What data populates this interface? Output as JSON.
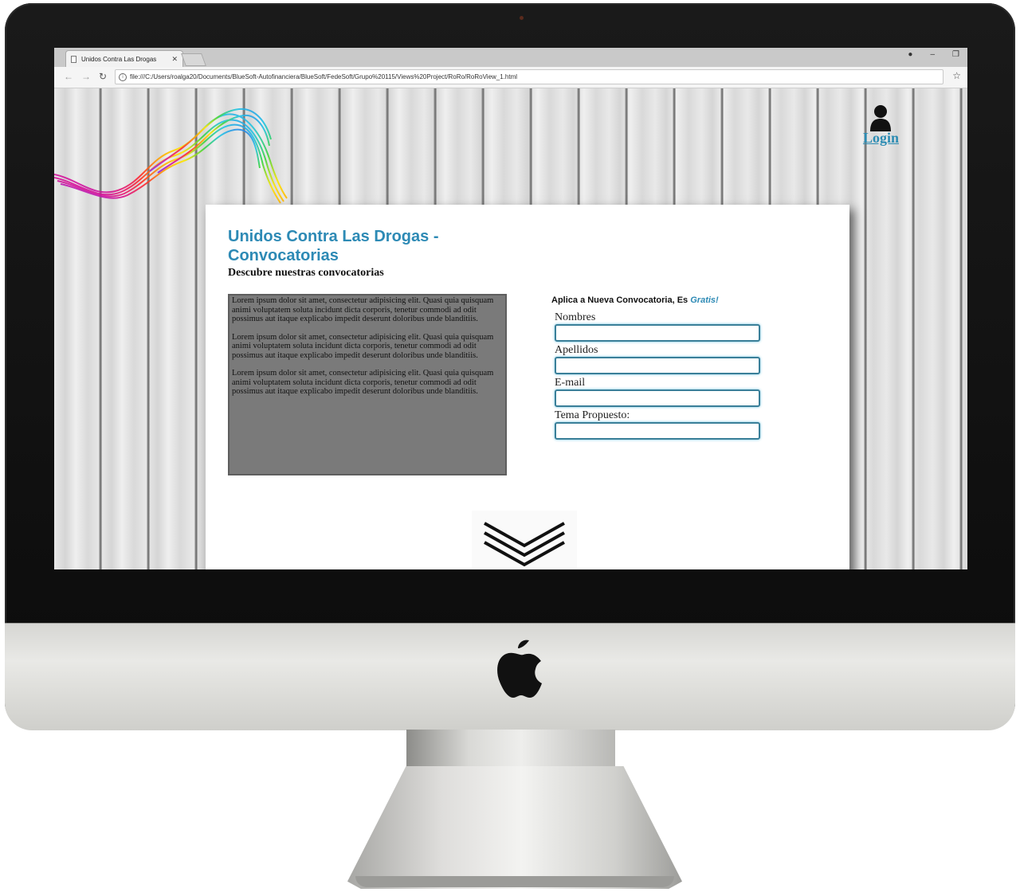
{
  "browser": {
    "tab_title": "Unidos Contra Las Drogas",
    "tab_close": "✕",
    "address": "file:///C:/Users/roalga20/Documents/BlueSoft-Autofinanciera/BlueSoft/FedeSoft/Grupo%20115/Views%20Project/RoRo/RoRoView_1.html",
    "controls": {
      "minimize": "–",
      "restore": "❐",
      "account": "●"
    }
  },
  "header": {
    "login_label": "Login"
  },
  "main": {
    "title": "Unidos Contra Las Drogas - Convocatorias",
    "subtitle": "Descubre nuestras convocatorias",
    "paragraphs": [
      "Lorem ipsum dolor sit amet, consectetur adipisicing elit. Quasi quia quisquam animi voluptatem soluta incidunt dicta corporis, tenetur commodi ad odit possimus aut itaque explicabo impedit deserunt doloribus unde blanditiis.",
      "Lorem ipsum dolor sit amet, consectetur adipisicing elit. Quasi quia quisquam animi voluptatem soluta incidunt dicta corporis, tenetur commodi ad odit possimus aut itaque explicabo impedit deserunt doloribus unde blanditiis.",
      "Lorem ipsum dolor sit amet, consectetur adipisicing elit. Quasi quia quisquam animi voluptatem soluta incidunt dicta corporis, tenetur commodi ad odit possimus aut itaque explicabo impedit deserunt doloribus unde blanditiis."
    ]
  },
  "form": {
    "heading": "Aplica a Nueva Convocatoria, Es ",
    "heading_emphasis": "Gratis!",
    "fields": [
      {
        "label": "Nombres",
        "value": ""
      },
      {
        "label": "Apellidos",
        "value": ""
      },
      {
        "label": "E-mail",
        "value": ""
      },
      {
        "label": "Tema Propuesto:",
        "value": ""
      }
    ]
  },
  "colors": {
    "accent": "#2d8ab5",
    "lorem_box": "#7a7a7a",
    "input_border": "#3a7f99"
  },
  "icons": [
    "doc-icon",
    "back-arrow-icon",
    "forward-arrow-icon",
    "reload-icon",
    "info-icon",
    "star-icon",
    "user-icon",
    "chevron-down-icon",
    "apple-logo-icon"
  ]
}
